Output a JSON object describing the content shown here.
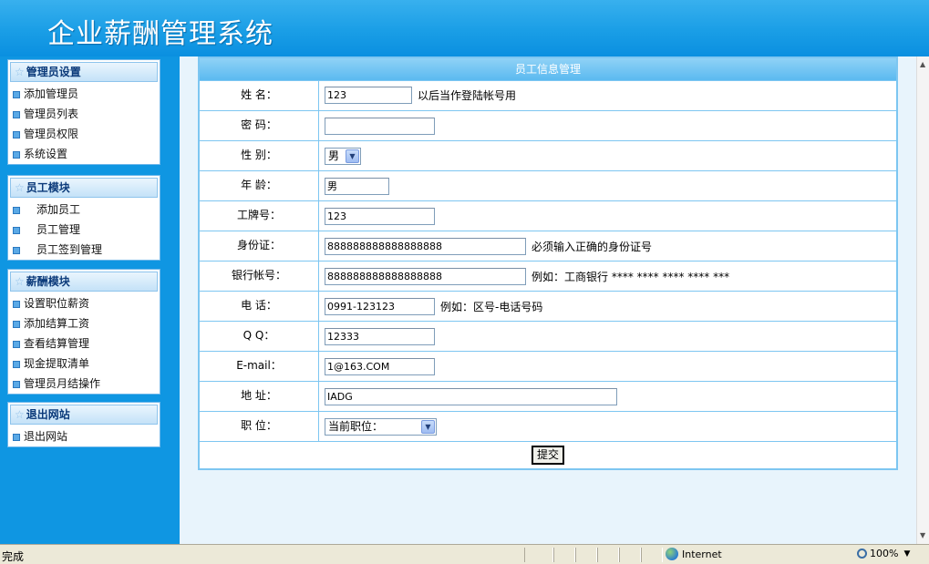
{
  "app": {
    "title": "企业薪酬管理系统"
  },
  "sidebar": {
    "sections": [
      {
        "heading": "管理员设置",
        "items": [
          "添加管理员",
          "管理员列表",
          "管理员权限",
          "系统设置"
        ]
      },
      {
        "heading": "员工模块",
        "items": [
          "添加员工",
          "员工管理",
          "员工签到管理"
        ]
      },
      {
        "heading": "薪酬模块",
        "items": [
          "设置职位薪资",
          "添加结算工资",
          "查看结算管理",
          "现金提取清单",
          "管理员月结操作"
        ]
      },
      {
        "heading": "退出网站",
        "items": [
          "退出网站"
        ]
      }
    ]
  },
  "form": {
    "title": "员工信息管理",
    "fields": {
      "name": {
        "label": "姓 名：",
        "value": "123",
        "hint": "以后当作登陆帐号用"
      },
      "password": {
        "label": "密 码：",
        "value": ""
      },
      "gender": {
        "label": "性 别：",
        "value": "男"
      },
      "age": {
        "label": "年 龄：",
        "value": "男"
      },
      "badge": {
        "label": "工牌号：",
        "value": "123"
      },
      "idcard": {
        "label": "身份证：",
        "value": "888888888888888888",
        "hint": "必须输入正确的身份证号"
      },
      "bank": {
        "label": "银行帐号：",
        "value": "888888888888888888",
        "hint": "例如：工商银行 **** **** **** **** ***"
      },
      "phone": {
        "label": "电 话：",
        "value": "0991-123123",
        "hint": "例如：区号-电话号码"
      },
      "qq": {
        "label": "Q Q：",
        "value": "12333"
      },
      "email": {
        "label": "E-mail：",
        "value": "1@163.COM"
      },
      "address": {
        "label": "地 址：",
        "value": "IADG"
      },
      "position": {
        "label": "职 位：",
        "value": "当前职位："
      }
    },
    "submit_label": "提交"
  },
  "statusbar": {
    "status": "完成",
    "zone": "Internet",
    "zoom": "100%"
  }
}
